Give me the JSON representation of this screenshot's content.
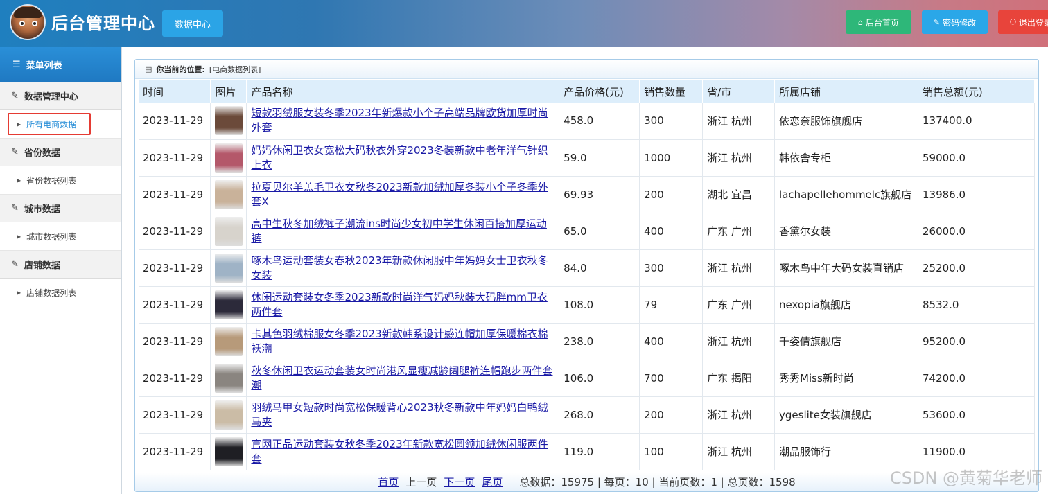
{
  "header": {
    "title": "后台管理中心",
    "datacenter_label": "数据中心",
    "home_label": "后台首页",
    "password_label": "密码修改",
    "logout_label": "退出登录"
  },
  "sidebar": {
    "menu_title": "菜单列表",
    "groups": [
      {
        "title": "数据管理中心",
        "item": "所有电商数据"
      },
      {
        "title": "省份数据",
        "item": "省份数据列表"
      },
      {
        "title": "城市数据",
        "item": "城市数据列表"
      },
      {
        "title": "店铺数据",
        "item": "店铺数据列表"
      }
    ]
  },
  "breadcrumb": {
    "label": "你当前的位置:",
    "value": "[电商数据列表]"
  },
  "table": {
    "headers": [
      "时间",
      "图片",
      "产品名称",
      "产品价格(元)",
      "销售数量",
      "省/市",
      "所属店铺",
      "销售总额(元)"
    ],
    "rows": [
      {
        "date": "2023-11-29",
        "name": "短款羽绒服女装冬季2023年新爆款小个子高端品牌欧货加厚时尚外套",
        "price": "458.0",
        "qty": "300",
        "region": "浙江 杭州",
        "shop": "依恋奈服饰旗舰店",
        "total": "137400.0",
        "color": "#6b4a3a"
      },
      {
        "date": "2023-11-29",
        "name": "妈妈休闲卫衣女宽松大码秋衣外穿2023冬装新款中老年洋气针织上衣",
        "price": "59.0",
        "qty": "1000",
        "region": "浙江 杭州",
        "shop": "韩依舍专柜",
        "total": "59000.0",
        "color": "#b4586a"
      },
      {
        "date": "2023-11-29",
        "name": "拉夏贝尔羊羔毛卫衣女秋冬2023新款加绒加厚冬装小个子冬季外套X",
        "price": "69.93",
        "qty": "200",
        "region": "湖北 宜昌",
        "shop": "lachapellehommelc旗舰店",
        "total": "13986.0",
        "color": "#c9b29a"
      },
      {
        "date": "2023-11-29",
        "name": "高中生秋冬加绒裤子潮流ins时尚少女初中学生休闲百搭加厚运动裤",
        "price": "65.0",
        "qty": "400",
        "region": "广东 广州",
        "shop": "香黛尔女装",
        "total": "26000.0",
        "color": "#d7d3cc"
      },
      {
        "date": "2023-11-29",
        "name": "啄木鸟运动套装女春秋2023年新款休闲服中年妈妈女士卫衣秋冬女装",
        "price": "84.0",
        "qty": "300",
        "region": "浙江 杭州",
        "shop": "啄木鸟中年大码女装直销店",
        "total": "25200.0",
        "color": "#9fb3c6"
      },
      {
        "date": "2023-11-29",
        "name": "休闲运动套装女冬季2023新款时尚洋气妈妈秋装大码胖mm卫衣两件套",
        "price": "108.0",
        "qty": "79",
        "region": "广东 广州",
        "shop": "nexopia旗舰店",
        "total": "8532.0",
        "color": "#2c2a3a"
      },
      {
        "date": "2023-11-29",
        "name": "卡其色羽绒棉服女冬季2023新款韩系设计感连帽加厚保暖棉衣棉袄潮",
        "price": "238.0",
        "qty": "400",
        "region": "浙江 杭州",
        "shop": "千姿倩旗舰店",
        "total": "95200.0",
        "color": "#b79a7a"
      },
      {
        "date": "2023-11-29",
        "name": "秋冬休闲卫衣运动套装女时尚港风显瘦减龄阔腿裤连帽跑步两件套潮",
        "price": "106.0",
        "qty": "700",
        "region": "广东 揭阳",
        "shop": "秀秀Miss新时尚",
        "total": "74200.0",
        "color": "#8a8580"
      },
      {
        "date": "2023-11-29",
        "name": "羽绒马甲女短款时尚宽松保暖背心2023秋冬新款中年妈妈白鸭绒马夹",
        "price": "268.0",
        "qty": "200",
        "region": "浙江 杭州",
        "shop": "ygeslite女装旗舰店",
        "total": "53600.0",
        "color": "#cbbca6"
      },
      {
        "date": "2023-11-29",
        "name": "官网正品运动套装女秋冬季2023年新款宽松圆领加绒休闲服两件套",
        "price": "119.0",
        "qty": "100",
        "region": "浙江 杭州",
        "shop": "潮品服饰行",
        "total": "11900.0",
        "color": "#1f1f24"
      }
    ]
  },
  "pager": {
    "first": "首页",
    "prev": "上一页",
    "next": "下一页",
    "last": "尾页",
    "summary": "总数据：15975 | 每页：10 | 当前页数：1 | 总页数：1598"
  },
  "watermark": "CSDN @黄菊华老师"
}
